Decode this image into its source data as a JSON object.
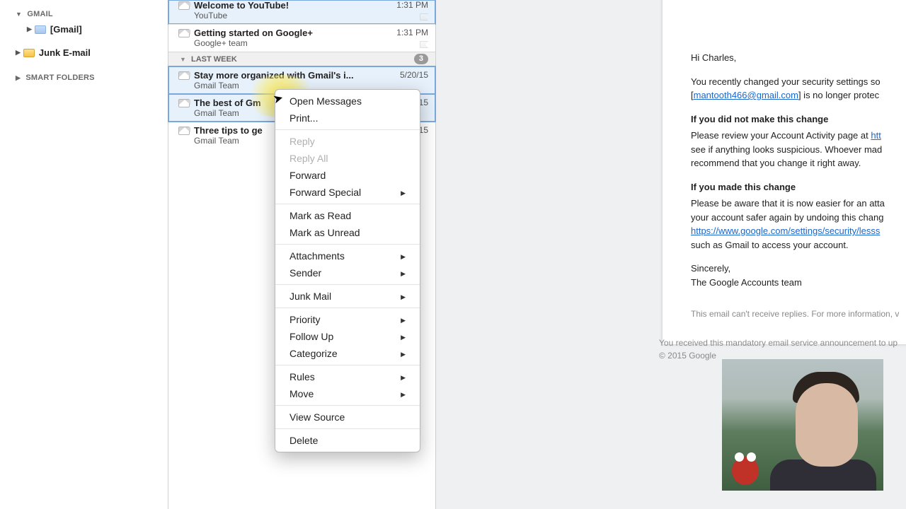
{
  "sidebar": {
    "sections": [
      {
        "label": "GMAIL",
        "items": [
          {
            "label": "[Gmail]",
            "bold": true,
            "icon": "folder"
          }
        ]
      },
      {
        "label": "",
        "items": [
          {
            "label": "Junk E-mail",
            "bold": true,
            "icon": "junk"
          }
        ]
      },
      {
        "label": "SMART FOLDERS",
        "items": []
      }
    ]
  },
  "list": {
    "top": [
      {
        "subject": "Welcome to YouTube!",
        "from": "YouTube",
        "time": "1:31 PM",
        "sel": true
      },
      {
        "subject": "Getting started on Google+",
        "from": "Google+ team",
        "time": "1:31 PM"
      }
    ],
    "section_header": "LAST WEEK",
    "section_count": "3",
    "week": [
      {
        "subject": "Stay more organized with Gmail's i...",
        "from": "Gmail Team",
        "time": "5/20/15",
        "sel": true
      },
      {
        "subject": "The best of Gm",
        "from": "Gmail Team",
        "time": "15",
        "sel": true
      },
      {
        "subject": "Three tips to ge",
        "from": "Gmail Team",
        "time": "15"
      }
    ]
  },
  "menu": [
    {
      "label": "Open Messages"
    },
    {
      "label": "Print..."
    },
    {
      "sep": true
    },
    {
      "label": "Reply",
      "disabled": true
    },
    {
      "label": "Reply All",
      "disabled": true
    },
    {
      "label": "Forward"
    },
    {
      "label": "Forward Special",
      "sub": true
    },
    {
      "sep": true
    },
    {
      "label": "Mark as Read"
    },
    {
      "label": "Mark as Unread"
    },
    {
      "sep": true
    },
    {
      "label": "Attachments",
      "sub": true
    },
    {
      "label": "Sender",
      "sub": true
    },
    {
      "sep": true
    },
    {
      "label": "Junk Mail",
      "sub": true
    },
    {
      "sep": true
    },
    {
      "label": "Priority",
      "sub": true
    },
    {
      "label": "Follow Up",
      "sub": true
    },
    {
      "label": "Categorize",
      "sub": true
    },
    {
      "sep": true
    },
    {
      "label": "Rules",
      "sub": true
    },
    {
      "label": "Move",
      "sub": true
    },
    {
      "sep": true
    },
    {
      "label": "View Source"
    },
    {
      "sep": true
    },
    {
      "label": "Delete"
    }
  ],
  "preview": {
    "greeting": "Hi Charles,",
    "p1a": "You recently changed your security settings so",
    "email_link": "mantooth466@gmail.com",
    "p1b": "] is no longer protec",
    "h1": "If you did not make this change",
    "p2a": "Please review your Account Activity page at ",
    "p2_linkstub": "htt",
    "p2b": "see if anything looks suspicious. Whoever mad",
    "p2c": "recommend that you change it right away.",
    "h2": "If you made this change",
    "p3a": "Please be aware that it is now easier for an atta",
    "p3b": "your account safer again by undoing this chang",
    "p3_link": "https://www.google.com/settings/security/lesss",
    "p3c": "such as Gmail to access your account.",
    "signoff": "Sincerely,",
    "team": "The Google Accounts team",
    "noreply": "This email can't receive replies. For more information, v",
    "footer1": "You received this mandatory email service announcement to up",
    "footer2": "© 2015 Google"
  }
}
